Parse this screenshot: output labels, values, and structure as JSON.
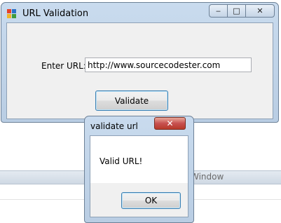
{
  "background": {
    "strip_text": "Window"
  },
  "main_window": {
    "title": "URL Validation",
    "app_icon": "app-icon",
    "caption_buttons": {
      "minimize": "‒",
      "maximize": "□",
      "close": "✕"
    },
    "form": {
      "url_label": "Enter URL:",
      "url_value": "http://www.sourcecodester.com",
      "validate_label": "Validate"
    }
  },
  "dialog": {
    "title": "validate url",
    "close_glyph": "✕",
    "message": "Valid URL!",
    "ok_label": "OK"
  }
}
